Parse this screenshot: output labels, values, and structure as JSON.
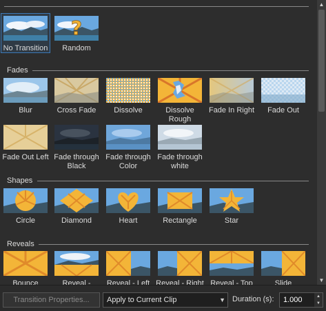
{
  "sections": [
    {
      "title": "",
      "name": "top"
    },
    {
      "title": "Fades",
      "name": "fades"
    },
    {
      "title": "Shapes",
      "name": "shapes"
    },
    {
      "title": "Reveals",
      "name": "reveals"
    }
  ],
  "top_tiles": [
    {
      "label": "No Transition",
      "icon": "landscape-thumb",
      "selected": true
    },
    {
      "label": "Random",
      "icon": "question-mark-thumb"
    }
  ],
  "fade_tiles": [
    {
      "label": "Blur",
      "icon": "blur-thumb"
    },
    {
      "label": "Cross Fade",
      "icon": "cross-fade-thumb"
    },
    {
      "label": "Dissolve",
      "icon": "dissolve-thumb"
    },
    {
      "label": "Dissolve Rough",
      "icon": "dissolve-rough-thumb"
    },
    {
      "label": "Fade In Right",
      "icon": "fade-in-right-thumb"
    },
    {
      "label": "Fade Out",
      "icon": "fade-out-thumb"
    },
    {
      "label": "Fade Out Left",
      "icon": "fade-out-left-thumb"
    },
    {
      "label": "Fade through Black",
      "icon": "fade-through-black-thumb"
    },
    {
      "label": "Fade through Color",
      "icon": "fade-through-color-thumb"
    },
    {
      "label": "Fade through white",
      "icon": "fade-through-white-thumb"
    }
  ],
  "shape_tiles": [
    {
      "label": "Circle",
      "icon": "circle-thumb"
    },
    {
      "label": "Diamond",
      "icon": "diamond-thumb"
    },
    {
      "label": "Heart",
      "icon": "heart-thumb"
    },
    {
      "label": "Rectangle",
      "icon": "rectangle-thumb"
    },
    {
      "label": "Star",
      "icon": "star-thumb"
    }
  ],
  "reveal_tiles": [
    {
      "label": "Bounce",
      "icon": "bounce-thumb"
    },
    {
      "label": "Reveal - ",
      "icon": "reveal-thumb"
    },
    {
      "label": "Reveal - Left",
      "icon": "reveal-left-thumb"
    },
    {
      "label": "Reveal - Right",
      "icon": "reveal-right-thumb"
    },
    {
      "label": "Reveal - Top",
      "icon": "reveal-top-thumb"
    },
    {
      "label": "Slide",
      "icon": "slide-thumb"
    }
  ],
  "bottom": {
    "properties_button": "Transition Properties...",
    "apply_select": "Apply to Current Clip",
    "duration_label": "Duration (s):",
    "duration_value": "1.000"
  },
  "colors": {
    "background": "#2d2d2d",
    "selection": "#3d7ab8",
    "sunburst": "#f3b538",
    "sky": "#5a9bd8"
  }
}
